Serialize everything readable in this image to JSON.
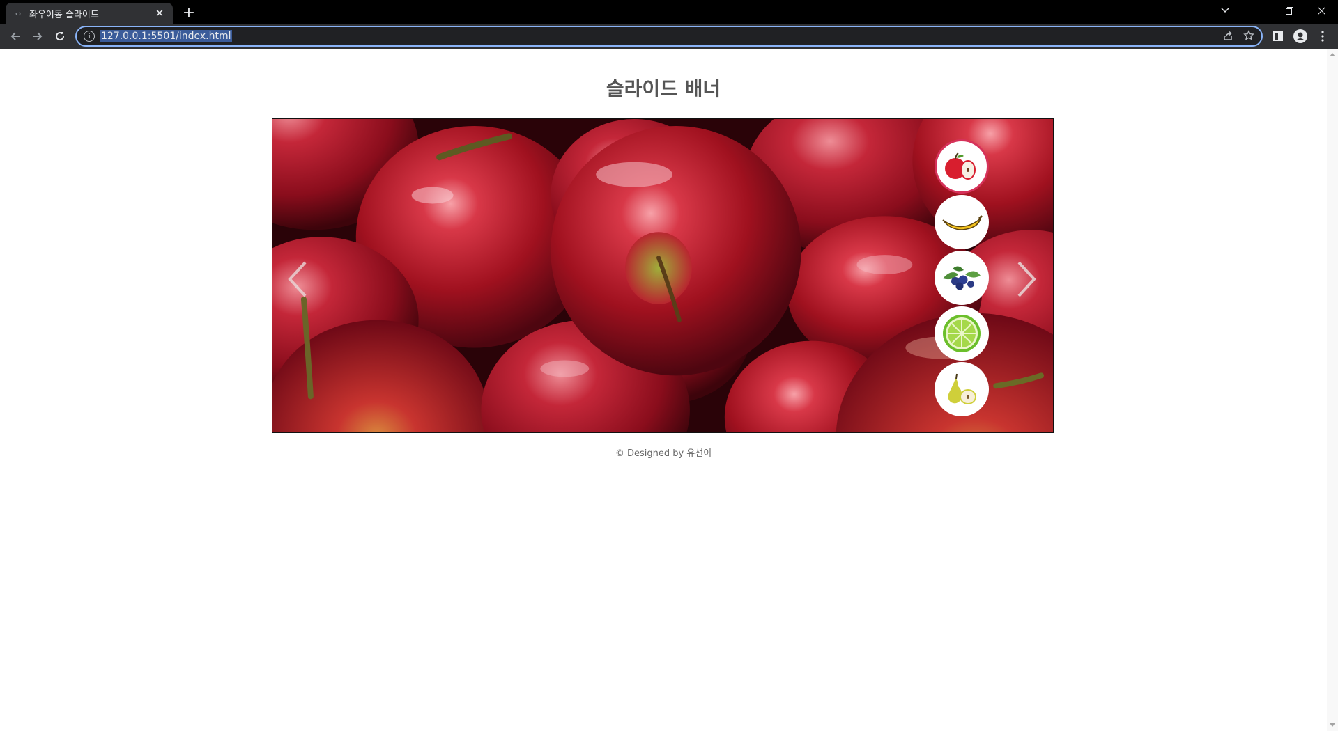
{
  "browser": {
    "tab_title": "좌우이동 슬라이드",
    "url": "127.0.0.1:5501/index.html",
    "colors": {
      "chrome_bg": "#000000",
      "toolbar_bg": "#303134",
      "focus_ring": "#8ab4f8"
    }
  },
  "page": {
    "title": "슬라이드 배너",
    "footer": "© Designed by 유선이",
    "slider": {
      "current_slide": "apple",
      "thumbnails": [
        {
          "fruit": "apple",
          "active": true
        },
        {
          "fruit": "banana",
          "active": false
        },
        {
          "fruit": "blueberry",
          "active": false
        },
        {
          "fruit": "lime",
          "active": false
        },
        {
          "fruit": "pear",
          "active": false
        }
      ],
      "active_color": "#d6325a"
    }
  }
}
